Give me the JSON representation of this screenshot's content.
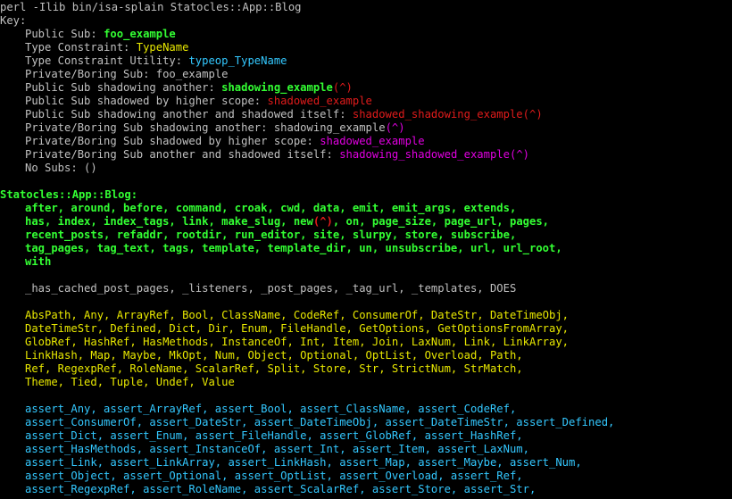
{
  "window": {
    "command": "perl -Ilib bin/isa-splain Statocles::App::Blog"
  },
  "key": {
    "header": "Key:",
    "items": [
      {
        "label": "Public Sub: ",
        "example": "foo_example",
        "color": "green",
        "marker": ""
      },
      {
        "label": "Type Constraint: ",
        "example": "TypeName",
        "color": "yellow",
        "marker": ""
      },
      {
        "label": "Type Constraint Utility: ",
        "example": "typeop_TypeName",
        "color": "cyan",
        "marker": ""
      },
      {
        "label": "Private/Boring Sub: ",
        "example": "foo_example",
        "color": "gray",
        "marker": ""
      },
      {
        "label": "Public Sub shadowing another: ",
        "example": "shadowing_example",
        "color": "green",
        "marker": "(^)"
      },
      {
        "label": "Public Sub shadowed by higher scope: ",
        "example": "shadowed_example",
        "color": "red",
        "marker": ""
      },
      {
        "label": "Public Sub shadowing another and shadowed itself: ",
        "example": "shadowed_shadowing_example(^)",
        "color": "red",
        "marker": ""
      },
      {
        "label": "Private/Boring Sub shadowing another: ",
        "example": "shadowing_example",
        "color": "gray",
        "marker": "(^)"
      },
      {
        "label": "Private/Boring Sub shadowed by higher scope: ",
        "example": "shadowed_example",
        "color": "magenta",
        "marker": ""
      },
      {
        "label": "Private/Boring Sub another and shadowed itself: ",
        "example": "shadowing_shadowed_example(^)",
        "color": "magenta",
        "marker": ""
      }
    ],
    "no_subs": "No Subs: ()"
  },
  "package": {
    "name": "Statocles::App::Blog:",
    "public_subs": [
      "after, around, before, command, croak, cwd, data, emit, emit_args, extends,",
      "has, index, index_tags, link, make_slug, new",
      "recent_posts, refaddr, rootdir, run_editor, site, slurpy, store, subscribe,",
      "tag_pages, tag_text, tags, template, template_dir, un, unsubscribe, url, url_root,",
      "with"
    ],
    "public_subs_line2_marker": "(^)",
    "public_subs_line2_rest": ", on, page_size, page_url, pages,",
    "private_subs": "_has_cached_post_pages, _listeners, _post_pages, _tag_url, _templates, DOES",
    "type_constraints": [
      "AbsPath, Any, ArrayRef, Bool, ClassName, CodeRef, ConsumerOf, DateStr, DateTimeObj,",
      "DateTimeStr, Defined, Dict, Dir, Enum, FileHandle, GetOptions, GetOptionsFromArray,",
      "GlobRef, HashRef, HasMethods, InstanceOf, Int, Item, Join, LaxNum, Link, LinkArray,",
      "LinkHash, Map, Maybe, MkOpt, Num, Object, Optional, OptList, Overload, Path,",
      "Ref, RegexpRef, RoleName, ScalarRef, Split, Store, Str, StrictNum, StrMatch,",
      "Theme, Tied, Tuple, Undef, Value"
    ],
    "type_utilities": [
      "assert_Any, assert_ArrayRef, assert_Bool, assert_ClassName, assert_CodeRef,",
      "assert_ConsumerOf, assert_DateStr, assert_DateTimeObj, assert_DateTimeStr, assert_Defined,",
      "assert_Dict, assert_Enum, assert_FileHandle, assert_GlobRef, assert_HashRef,",
      "assert_HasMethods, assert_InstanceOf, assert_Int, assert_Item, assert_LaxNum,",
      "assert_Link, assert_LinkArray, assert_LinkHash, assert_Map, assert_Maybe, assert_Num,",
      "assert_Object, assert_Optional, assert_OptList, assert_Overload, assert_Ref,",
      "assert_RegexpRef, assert_RoleName, assert_ScalarRef, assert_Store, assert_Str,"
    ]
  },
  "colors": {
    "background": "#000000",
    "plain": "#c0c0c0",
    "public_sub": "#33ff33",
    "type_constraint": "#e8e800",
    "type_utility": "#33c8ff",
    "shadowed": "#e01b1b",
    "private_shadowed": "#e000e0"
  }
}
